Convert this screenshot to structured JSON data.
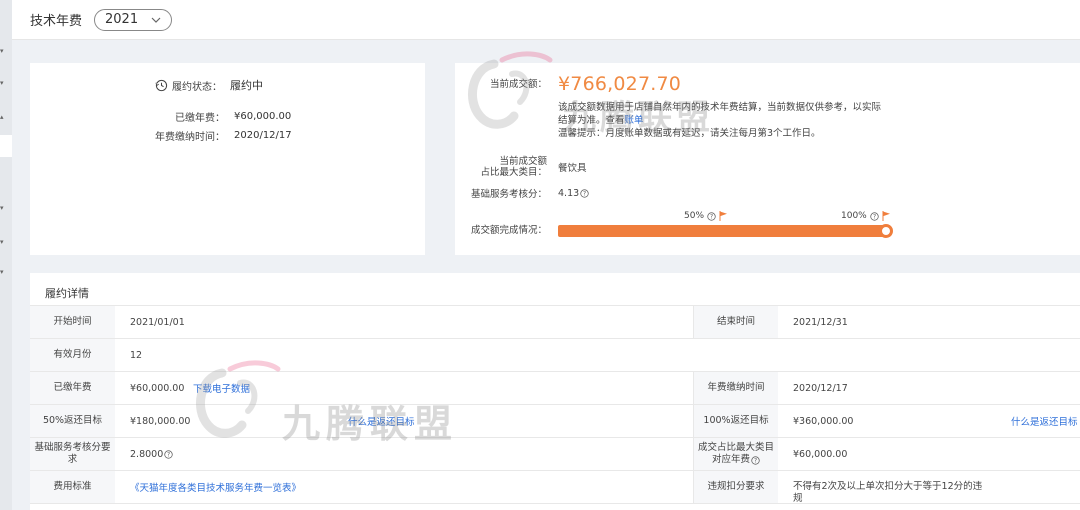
{
  "header": {
    "title": "技术年费",
    "year": "2021"
  },
  "summary": {
    "status_label": "履约状态：",
    "status_value": "履约中",
    "paid_label": "已缴年费：",
    "paid_value": "¥60,000.00",
    "pay_time_label": "年费缴纳时间：",
    "pay_time_value": "2020/12/17"
  },
  "deal": {
    "amount_label": "当前成交额：",
    "amount_value": "¥766,027.70",
    "desc_line1": "该成交额数据用于店铺自然年内的技术年费结算，当前数据仅供参考，以实际",
    "desc_line2_prefix": "结算为准。查看",
    "desc_link": "账单",
    "tip": "温馨提示：月度账单数据或有延迟，请关注每月第3个工作日。",
    "category_label_1": "当前成交额",
    "category_label_2": "占比最大类目：",
    "category_value": "餐饮具",
    "score_label": "基础服务考核分：",
    "score_value": "4.13",
    "progress_label": "成交额完成情况：",
    "marker_50": "50%",
    "marker_100": "100%",
    "progress_fraction": 1.0,
    "accent_color": "#f07e3c"
  },
  "details": {
    "title": "履约详情",
    "rows": [
      {
        "l1": "开始时间",
        "v1": "2021/01/01",
        "l2": "结束时间",
        "v2": "2021/12/31"
      },
      {
        "l1": "有效月份",
        "v1": "12"
      },
      {
        "l1": "已缴年费",
        "v1": "¥60,000.00",
        "link1": "下载电子数据",
        "l2": "年费缴纳时间",
        "v2": "2020/12/17"
      },
      {
        "l1": "50%返还目标",
        "v1": "¥180,000.00",
        "link1": "什么是返还目标",
        "l2": "100%返还目标",
        "v2": "¥360,000.00",
        "link2": "什么是返还目标"
      },
      {
        "l1a": "基础服务考核分要",
        "l1b": "求",
        "v1": "2.8000",
        "l2a": "成交占比最大类目",
        "l2b": "对应年费",
        "v2": "¥60,000.00"
      },
      {
        "l1": "费用标准",
        "v1link": "《天猫年度各类目技术服务年费一览表》",
        "l2": "违规扣分要求",
        "v2": "不得有2次及以上单次扣分大于等于12分的违",
        "v2b": "规"
      }
    ]
  },
  "watermark": "九腾联盟"
}
